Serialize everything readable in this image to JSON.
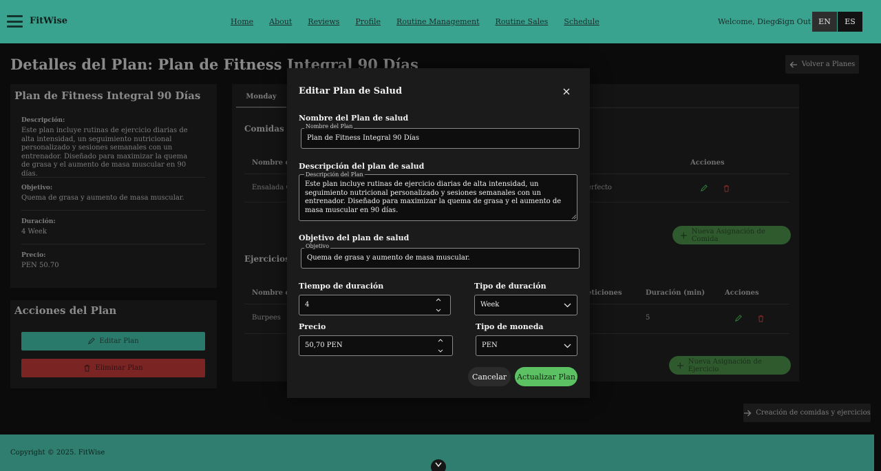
{
  "header": {
    "brand": "FitWise",
    "nav": [
      "Home",
      "About",
      "Reviews",
      "Profile",
      "Routine Management",
      "Routine Sales",
      "Schedule"
    ],
    "welcome": "Welcome, Diego",
    "sign_out": "Sign Out",
    "lang_en": "EN",
    "lang_es": "ES"
  },
  "page": {
    "title": "Detalles del Plan: Plan de Fitness Integral 90 Días",
    "back_label": "Volver a Planes"
  },
  "plan": {
    "name": "Plan de Fitness Integral 90 Días",
    "description_label": "Descripción:",
    "description": "Este plan incluye rutinas de ejercicio diarias de alta intensidad, un seguimiento nutricional personalizado y sesiones semanales con un entrenador. Diseñado para maximizar la quema de grasa y el aumento de masa muscular en 90 días.",
    "objective_label": "Objetivo:",
    "objective": "Quema de grasa y aumento de masa muscular.",
    "duration_label": "Duración:",
    "duration": "4 Week",
    "price_label": "Precio:",
    "price": "PEN 50.70"
  },
  "plan_actions": {
    "title": "Acciones del Plan",
    "edit_label": "Editar Plan",
    "delete_label": "Eliminar Plan"
  },
  "schedule": {
    "tab": "Monday",
    "meals_title": "Comidas d",
    "meals_headers": {
      "name": "Nombre de",
      "actions": "Acciones"
    },
    "meals_rows": [
      {
        "name": "Ensalada Q",
        "note": "erfecto"
      }
    ],
    "add_meal_label": "Nueva Asignación de Comida",
    "exercises_title": "Ejercicios d",
    "exercises_headers": {
      "name": "Nombre de",
      "reps": "eticiones",
      "duration": "Duración (min)",
      "actions": "Acciones"
    },
    "exercises_rows": [
      {
        "name": "Burpees",
        "duration": "5"
      }
    ],
    "add_exercise_label": "Nueva Asignación de Ejercicio"
  },
  "creation_label": "Creación de comidas y ejercicios",
  "footer": {
    "copyright": "Copyright © 2025. FitWise"
  },
  "modal": {
    "title": "Editar Plan de Salud",
    "name_title": "Nombre del Plan de salud",
    "name_legend": "Nombre del Plan",
    "name_value": "Plan de Fitness Integral 90 Días",
    "desc_title": "Descripción del plan de salud",
    "desc_legend": "Descripción del Plan",
    "desc_value": "Este plan incluye rutinas de ejercicio diarias de alta intensidad, un seguimiento nutricional personalizado y sesiones semanales con un entrenador. Diseñado para maximizar la quema de grasa y el aumento de masa muscular en 90 días.",
    "objective_title": "Objetivo del plan de salud",
    "objective_legend": "Objetivo",
    "objective_value": "Quema de grasa y aumento de masa muscular.",
    "duration_title": "Tiempo de duración",
    "duration_value": "4",
    "duration_type_title": "Tipo de duración",
    "duration_type_value": "Week",
    "price_title": "Precio",
    "price_value": "50,70 PEN",
    "currency_title": "Tipo de moneda",
    "currency_value": "PEN",
    "cancel_label": "Cancelar",
    "update_label": "Actualizar Plan"
  },
  "colors": {
    "header_bg": "#3aa38f",
    "footer_bg": "#2f7e6f",
    "update_button": "#5cc163",
    "delete_button": "#7a2424"
  }
}
